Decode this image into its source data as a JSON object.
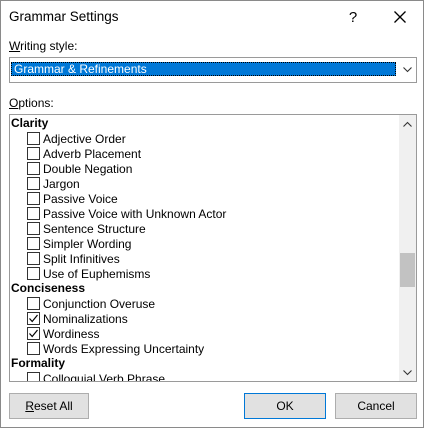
{
  "dialog": {
    "title": "Grammar Settings",
    "help_label": "?"
  },
  "writing_style": {
    "label_accel": "W",
    "label_rest": "riting style:",
    "selected_value": "Grammar & Refinements"
  },
  "options": {
    "label_accel": "O",
    "label_rest": "ptions:",
    "categories": [
      {
        "name": "Clarity",
        "items": [
          {
            "label": "Adjective Order",
            "checked": false
          },
          {
            "label": "Adverb Placement",
            "checked": false
          },
          {
            "label": "Double Negation",
            "checked": false
          },
          {
            "label": "Jargon",
            "checked": false
          },
          {
            "label": "Passive Voice",
            "checked": false
          },
          {
            "label": "Passive Voice with Unknown Actor",
            "checked": false
          },
          {
            "label": "Sentence Structure",
            "checked": false
          },
          {
            "label": "Simpler Wording",
            "checked": false
          },
          {
            "label": "Split Infinitives",
            "checked": false
          },
          {
            "label": "Use of Euphemisms",
            "checked": false
          }
        ]
      },
      {
        "name": "Conciseness",
        "items": [
          {
            "label": "Conjunction Overuse",
            "checked": false
          },
          {
            "label": "Nominalizations",
            "checked": true
          },
          {
            "label": "Wordiness",
            "checked": true
          },
          {
            "label": "Words Expressing Uncertainty",
            "checked": false
          }
        ]
      },
      {
        "name": "Formality",
        "items": [
          {
            "label": "Colloquial Verb Phrase",
            "checked": false
          }
        ]
      }
    ]
  },
  "buttons": {
    "reset_accel": "R",
    "reset_rest": "eset All",
    "ok": "OK",
    "cancel": "Cancel"
  },
  "icons": {
    "close": "close-icon",
    "dropdown": "chevron-down-icon",
    "scroll_up": "chevron-up-icon",
    "scroll_down": "chevron-down-icon",
    "checkmark": "checkmark-icon"
  },
  "colors": {
    "selection": "#0078d7",
    "button_face": "#e1e1e1",
    "scroll_track": "#f0f0f0",
    "scroll_thumb": "#c2c2c2"
  }
}
